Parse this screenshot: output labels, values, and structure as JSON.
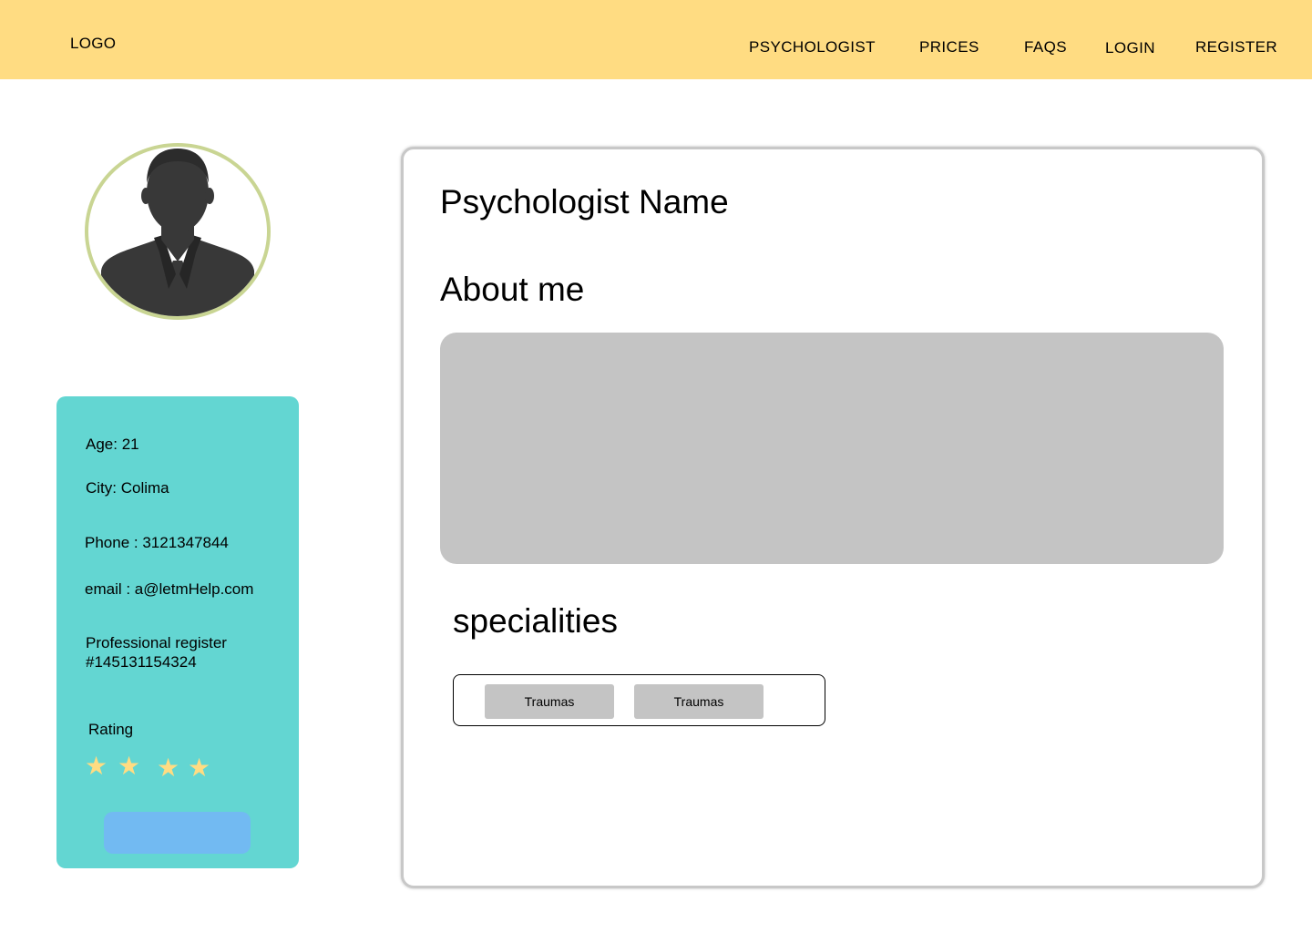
{
  "header": {
    "logo": "LOGO",
    "nav": [
      "PSYCHOLOGIST",
      "PRICES",
      "FAQS",
      "LOGIN",
      "REGISTER"
    ],
    "background_color": "#ffdc82"
  },
  "profile": {
    "avatar_icon": "user-silhouette-icon",
    "age": "Age:  21",
    "city": "City:  Colima",
    "phone": "Phone : 3121347844",
    "email": "email : a@letmHelp.com",
    "register_line1": "Professional register",
    "register_line2": "#145131154324",
    "rating_label": "Rating",
    "rating_stars": 4,
    "star_glyph": "★",
    "card_color": "#63d6d2",
    "button_color": "#72baf2",
    "button_label": ""
  },
  "main": {
    "name": "Psychologist Name",
    "about_title": "About me",
    "about_text": "",
    "specialities_title": "specialities",
    "specialities": [
      "Traumas",
      "Traumas"
    ]
  }
}
